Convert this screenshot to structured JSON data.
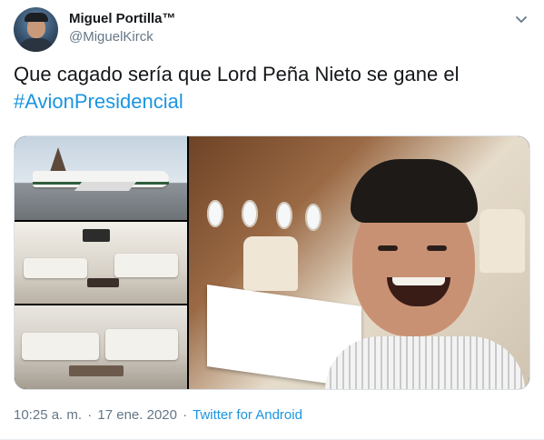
{
  "user": {
    "display_name": "Miguel Portilla™",
    "handle": "@MiguelKirck",
    "avatar_icon": "user-avatar"
  },
  "tweet": {
    "text": "Que cagado sería que Lord Peña Nieto se gane el",
    "hashtag": "#AvionPresidencial",
    "hashtag_color": "#1b95e0"
  },
  "media": {
    "panels": [
      "presidential-airplane-exterior",
      "airplane-cabin-lounge",
      "airplane-cabin-seating",
      "man-laughing-in-airplane-dining-cabin"
    ]
  },
  "meta": {
    "time": "10:25 a. m.",
    "separator": "·",
    "date": "17 ene. 2020",
    "source": "Twitter for Android"
  },
  "menu": {
    "icon": "chevron-down-icon"
  }
}
